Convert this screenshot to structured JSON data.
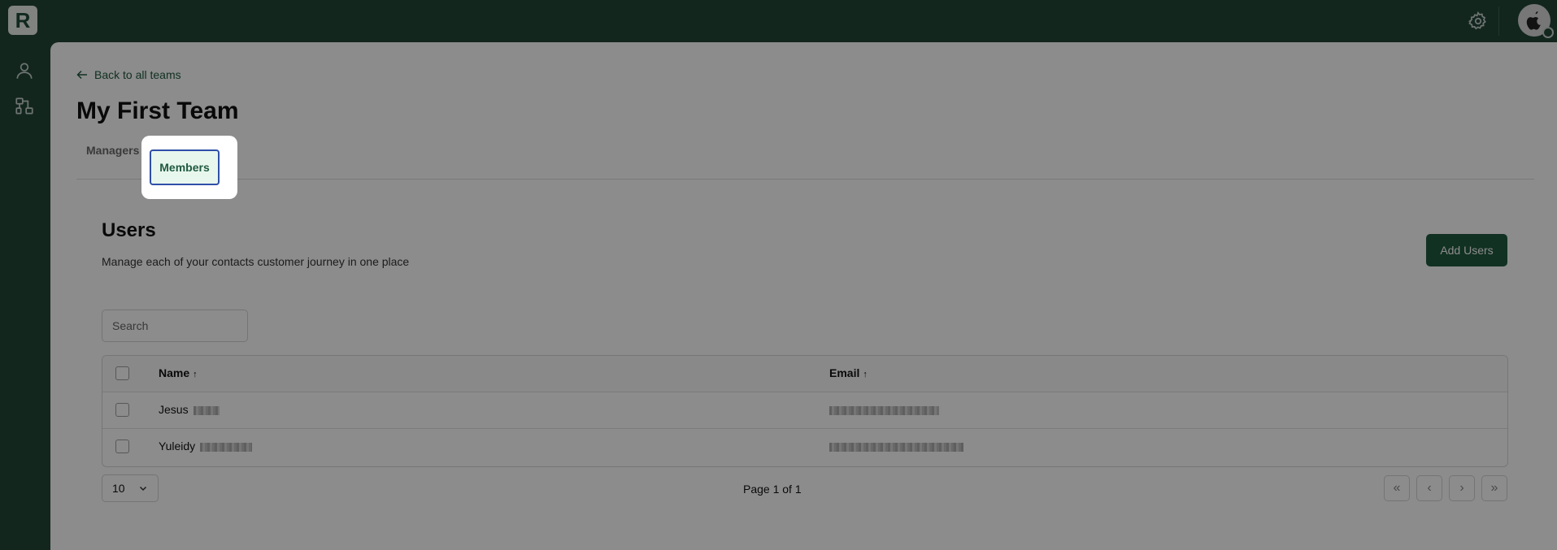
{
  "app": {
    "logo_letter": "R"
  },
  "header": {
    "settings_icon": "gear-icon",
    "avatar_icon": "apple-icon"
  },
  "sidebar": {
    "items": [
      {
        "icon": "user-icon"
      },
      {
        "icon": "org-chart-icon"
      }
    ]
  },
  "breadcrumb": {
    "back_label": "Back to all teams"
  },
  "page": {
    "title": "My First Team"
  },
  "tabs": [
    {
      "label": "Managers"
    },
    {
      "label": "Members",
      "active": true
    }
  ],
  "users_section": {
    "title": "Users",
    "description": "Manage each of your contacts customer journey in one place",
    "add_button": "Add Users",
    "search_placeholder": "Search"
  },
  "table": {
    "columns": [
      {
        "label": "Name",
        "sort": "↑"
      },
      {
        "label": "Email",
        "sort": "↑"
      }
    ],
    "rows": [
      {
        "name": "Jesus"
      },
      {
        "name": "Yuleidy"
      }
    ]
  },
  "pagination": {
    "page_size": "10",
    "page_info": "Page 1 of 1"
  },
  "colors": {
    "brand": "#214537",
    "accent": "#1f5a3f",
    "focus": "#2f4fa8"
  }
}
